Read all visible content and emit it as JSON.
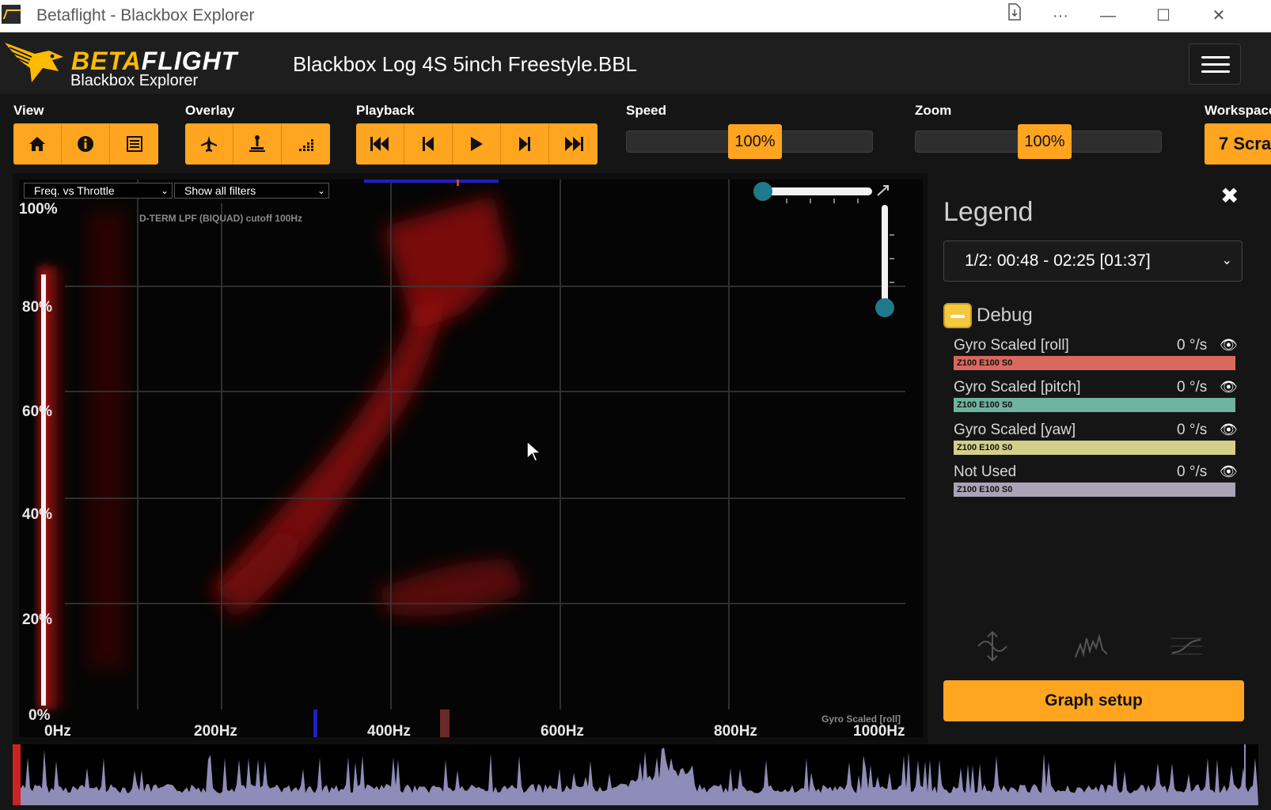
{
  "window": {
    "title": "Betaflight - Blackbox Explorer"
  },
  "header": {
    "brand_prefix": "BETA",
    "brand_suffix": "FLIGHT",
    "brand_sub": "Blackbox Explorer",
    "log_title": "Blackbox Log 4S 5inch Freestyle.BBL"
  },
  "toolbar": {
    "view_label": "View",
    "overlay_label": "Overlay",
    "playback_label": "Playback",
    "speed_label": "Speed",
    "speed_value": "100%",
    "zoom_label": "Zoom",
    "zoom_value": "100%",
    "workspace_label": "Workspace",
    "workspace_button": "7 Scra"
  },
  "graph": {
    "mode_select": "Freq. vs Throttle",
    "filter_select": "Show all filters",
    "filter_annotation": "D-TERM LPF (BIQUAD) cutoff 100Hz",
    "series_annotation": "Gyro Scaled [roll]",
    "y_ticks": [
      "100%",
      "80%",
      "60%",
      "40%",
      "20%",
      "0%"
    ],
    "x_ticks": [
      "0Hz",
      "200Hz",
      "400Hz",
      "600Hz",
      "800Hz",
      "1000Hz"
    ]
  },
  "legend": {
    "title": "Legend",
    "range_select": "1/2: 00:48 - 02:25 [01:37]",
    "group_label": "Debug",
    "series": [
      {
        "name": "Gyro Scaled [roll]",
        "value": "0 °/s",
        "settings": "Z100 E100 S0",
        "color": "#d9685e"
      },
      {
        "name": "Gyro Scaled [pitch]",
        "value": "0 °/s",
        "settings": "Z100 E100 S0",
        "color": "#6fb39e"
      },
      {
        "name": "Gyro Scaled [yaw]",
        "value": "0 °/s",
        "settings": "Z100 E100 S0",
        "color": "#d3cf8a"
      },
      {
        "name": "Not Used",
        "value": "0 °/s",
        "settings": "Z100 E100 S0",
        "color": "#a9a4b8"
      }
    ],
    "graph_setup_button": "Graph setup"
  },
  "colors": {
    "accent": "#ffa520",
    "background": "#151515"
  }
}
